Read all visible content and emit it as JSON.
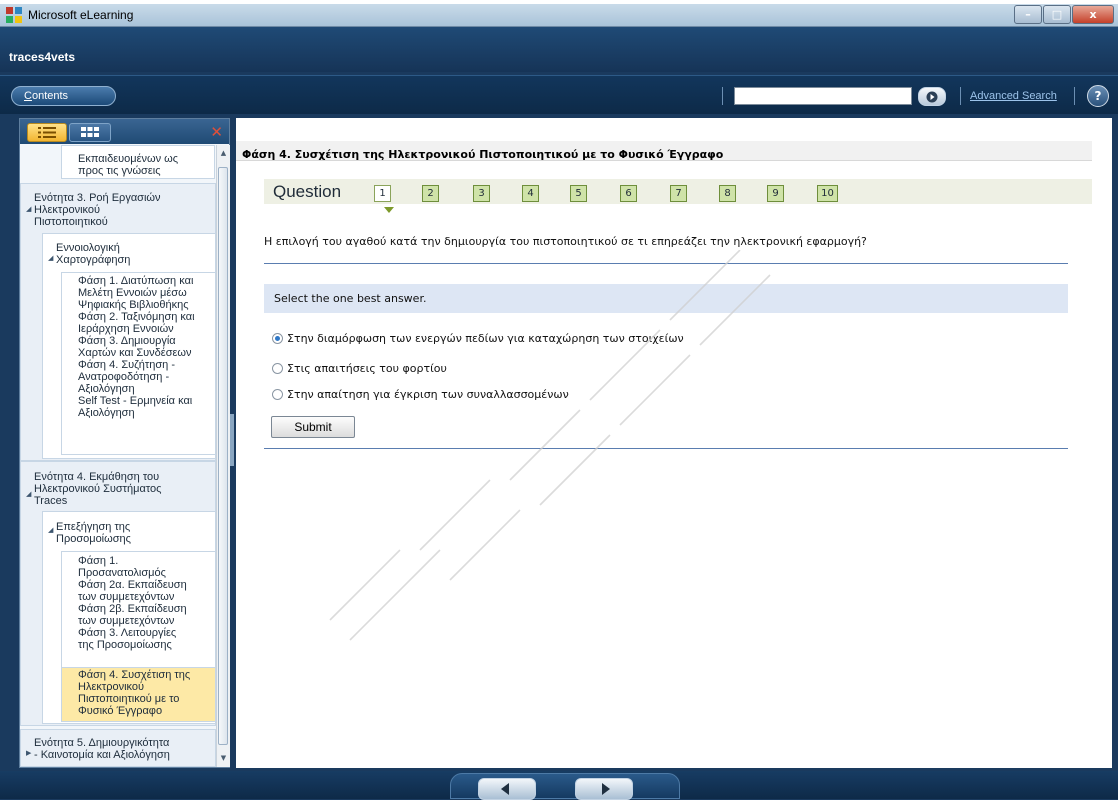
{
  "window": {
    "title": "Microsoft eLearning",
    "minimize_glyph": "–",
    "maximize_glyph": "□",
    "close_glyph": "x"
  },
  "header": {
    "app_name": "traces4vets"
  },
  "toolbar": {
    "contents_label_hotkey": "C",
    "contents_label_rest": "ontents",
    "search_value": "",
    "advanced_search": "Advanced Search",
    "help": "?"
  },
  "toc": {
    "items": [
      {
        "text": "Εκπαιδευομένων ως",
        "level": 3
      },
      {
        "text": "προς τις γνώσεις",
        "level": 3
      },
      {
        "text": "Ενότητα 3. Ροή Εργασιών",
        "level": 1
      },
      {
        "text": "Ηλεκτρονικού",
        "level": 1
      },
      {
        "text": "Πιστοποιητικού",
        "level": 1
      },
      {
        "text": "Εννοιολογική",
        "level": 2
      },
      {
        "text": "Χαρτογράφηση",
        "level": 2
      },
      {
        "text": "Φάση 1. Διατύπωση και",
        "level": 3
      },
      {
        "text": "Μελέτη Εννοιών μέσω",
        "level": 3
      },
      {
        "text": "Ψηφιακής Βιβλιοθήκης",
        "level": 3
      },
      {
        "text": "Φάση 2. Ταξινόμηση και",
        "level": 3
      },
      {
        "text": "Ιεράρχηση Εννοιών",
        "level": 3
      },
      {
        "text": "Φάση 3. Δημιουργία",
        "level": 3
      },
      {
        "text": "Χαρτών και Συνδέσεων",
        "level": 3
      },
      {
        "text": "Φάση 4. Συζήτηση -",
        "level": 3
      },
      {
        "text": "Ανατροφοδότηση -",
        "level": 3
      },
      {
        "text": "Αξιολόγηση",
        "level": 3
      },
      {
        "text": "Self Test - Ερμηνεία και",
        "level": 3
      },
      {
        "text": "Αξιολόγηση",
        "level": 3
      },
      {
        "text": "Ενότητα 4. Εκμάθηση του",
        "level": 1
      },
      {
        "text": "Ηλεκτρονικού Συστήματος",
        "level": 1
      },
      {
        "text": "Traces",
        "level": 1
      },
      {
        "text": "Επεξήγηση της",
        "level": 2
      },
      {
        "text": "Προσομοίωσης",
        "level": 2
      },
      {
        "text": "Φάση 1.",
        "level": 3
      },
      {
        "text": "Προσανατολισμός",
        "level": 3
      },
      {
        "text": "Φάση 2α. Εκπαίδευση",
        "level": 3
      },
      {
        "text": "των συμμετεχόντων",
        "level": 3
      },
      {
        "text": "Φάση 2β. Εκπαίδευση",
        "level": 3
      },
      {
        "text": "των συμμετεχόντων",
        "level": 3
      },
      {
        "text": "Φάση 3. Λειτουργίες",
        "level": 3
      },
      {
        "text": "της Προσομοίωσης",
        "level": 3
      },
      {
        "text": "Φάση 4. Συσχέτιση της",
        "level": 3
      },
      {
        "text": "Ηλεκτρονικού",
        "level": 3
      },
      {
        "text": "Πιστοποιητικού με το",
        "level": 3
      },
      {
        "text": "Φυσικό Έγγραφο",
        "level": 3
      },
      {
        "text": "Ενότητα 5. Δημιουργικότητα",
        "level": 1
      },
      {
        "text": "- Καινοτομία και Αξιολόγηση",
        "level": 1
      }
    ]
  },
  "main": {
    "page_title": "Φάση 4. Συσχέτιση της Ηλεκτρονικού Πιστοποιητικού με το Φυσικό Έγγραφο",
    "question_label": "Question",
    "question_numbers": [
      "1",
      "2",
      "3",
      "4",
      "5",
      "6",
      "7",
      "8",
      "9",
      "10"
    ],
    "current_question": "1",
    "question_text": "Η επιλογή του αγαθού κατά την δημιουργία του πιστοποιητικού σε τι επηρεάζει την ηλεκτρονική εφαρμογή?",
    "instruction": "Select the one best answer.",
    "answers": [
      {
        "text": "Στην διαμόρφωση των ενεργών πεδίων για καταχώρηση των στοιχείων",
        "selected": true
      },
      {
        "text": "Στις απαιτήσεις του φορτίου",
        "selected": false
      },
      {
        "text": "Στην απαίτηση για έγκριση των συναλλασσομένων",
        "selected": false
      }
    ],
    "submit_label": "Submit"
  },
  "colors": {
    "accent": "#163457",
    "question_box": "#cfe3a8",
    "instruction_bg": "#dde6f4",
    "selected_toc": "#fde9a6"
  },
  "icons": {
    "app_icon": "elearning-grid-icon",
    "list_view": "list-view-icon",
    "grid_view": "grid-view-icon",
    "close_pane": "close-x-icon",
    "go": "play-arrow-icon",
    "help": "help-circle-icon",
    "prev": "arrow-left-icon",
    "next": "arrow-right-icon"
  }
}
